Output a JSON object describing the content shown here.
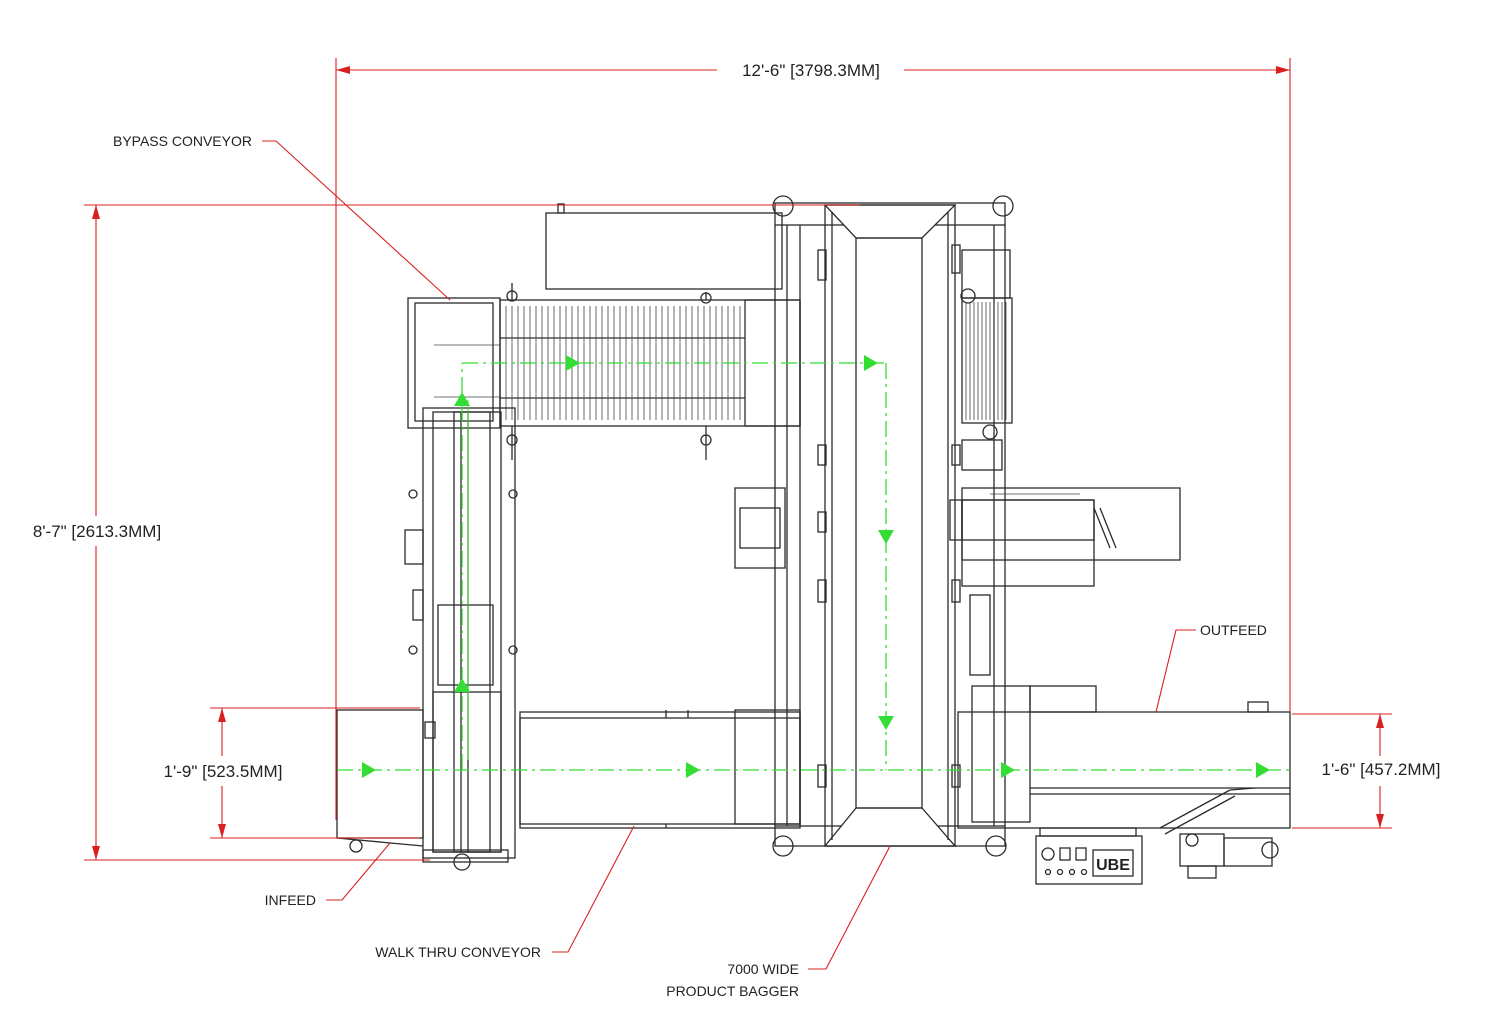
{
  "dimensions": {
    "overall_width": "12'-6\" [3798.3MM]",
    "overall_depth": "8'-7\" [2613.3MM]",
    "infeed_height": "1'-9\" [523.5MM]",
    "outfeed_height": "1'-6\" [457.2MM]"
  },
  "callouts": {
    "bypass": "BYPASS CONVEYOR",
    "outfeed": "OUTFEED",
    "infeed": "INFEED",
    "walk_thru": "WALK THRU CONVEYOR",
    "bagger_line1": "7000 WIDE",
    "bagger_line2": "PRODUCT BAGGER"
  },
  "control_panel": {
    "logo": "UBE"
  },
  "colors": {
    "dimension_lines": "#d92020",
    "product_flow": "#33dd33",
    "linework": "#2b2b2b"
  }
}
